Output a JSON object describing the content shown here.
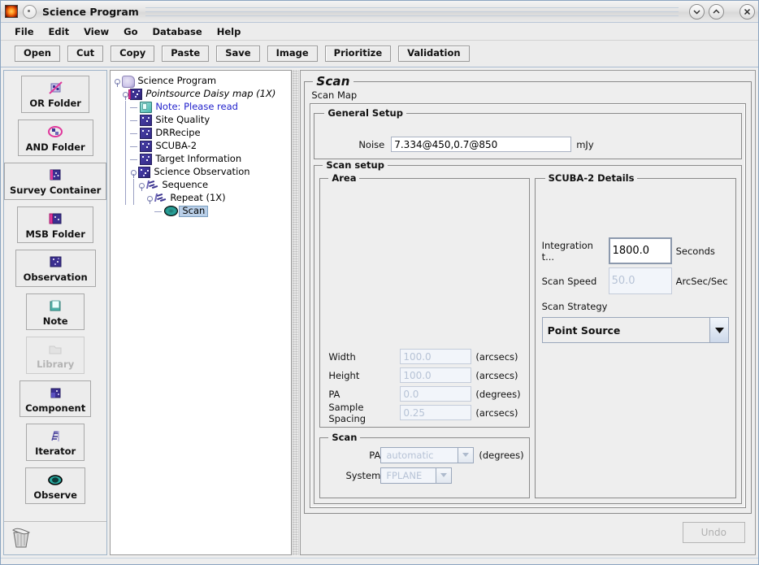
{
  "window": {
    "title": "Science Program",
    "controls": [
      {
        "name": "minimize-button",
        "glyph": "chevron-down"
      },
      {
        "name": "maximize-button",
        "glyph": "chevron-up"
      },
      {
        "name": "close-button",
        "glyph": "x"
      }
    ]
  },
  "menubar": {
    "items": [
      "File",
      "Edit",
      "View",
      "Go",
      "Database",
      "Help"
    ]
  },
  "toolbar": {
    "buttons": [
      "Open",
      "Cut",
      "Copy",
      "Paste",
      "Save",
      "Image",
      "Prioritize",
      "Validation"
    ]
  },
  "palette": {
    "items": [
      {
        "label": "OR Folder",
        "icon": "or-folder-icon",
        "disabled": false
      },
      {
        "label": "AND Folder",
        "icon": "and-folder-icon",
        "disabled": false
      },
      {
        "label": "Survey Container",
        "icon": "survey-container-icon",
        "disabled": false
      },
      {
        "label": "MSB Folder",
        "icon": "msb-folder-icon",
        "disabled": false
      },
      {
        "label": "Observation",
        "icon": "observation-icon",
        "disabled": false
      },
      {
        "label": "Note",
        "icon": "note-icon",
        "disabled": false
      },
      {
        "label": "Library",
        "icon": "library-icon",
        "disabled": true
      },
      {
        "label": "Component",
        "icon": "component-icon",
        "disabled": false
      },
      {
        "label": "Iterator",
        "icon": "iterator-icon",
        "disabled": false
      },
      {
        "label": "Observe",
        "icon": "observe-eye-icon",
        "disabled": false
      }
    ],
    "trash_icon": "trash-icon"
  },
  "tree": {
    "nodes": [
      {
        "label": "Science Program",
        "icon": "program-icon",
        "depth": 0,
        "handle": true,
        "italic": false,
        "note": false,
        "selected": false
      },
      {
        "label": "Pointsource Daisy map (1X)",
        "icon": "msb-icon",
        "depth": 1,
        "handle": true,
        "italic": true,
        "note": false,
        "selected": false
      },
      {
        "label": "Note: Please read",
        "icon": "note-icon",
        "depth": 2,
        "handle": false,
        "italic": false,
        "note": true,
        "selected": false
      },
      {
        "label": "Site Quality",
        "icon": "component-icon",
        "depth": 2,
        "handle": false,
        "italic": false,
        "note": false,
        "selected": false
      },
      {
        "label": "DRRecipe",
        "icon": "component-icon",
        "depth": 2,
        "handle": false,
        "italic": false,
        "note": false,
        "selected": false
      },
      {
        "label": "SCUBA-2",
        "icon": "component-icon",
        "depth": 2,
        "handle": false,
        "italic": false,
        "note": false,
        "selected": false
      },
      {
        "label": "Target Information",
        "icon": "component-icon",
        "depth": 2,
        "handle": false,
        "italic": false,
        "note": false,
        "selected": false
      },
      {
        "label": "Science Observation",
        "icon": "observation-icon",
        "depth": 2,
        "handle": true,
        "italic": false,
        "note": false,
        "selected": false
      },
      {
        "label": "Sequence",
        "icon": "sequence-icon",
        "depth": 3,
        "handle": true,
        "italic": false,
        "note": false,
        "selected": false
      },
      {
        "label": "Repeat (1X)",
        "icon": "iterator-icon",
        "depth": 4,
        "handle": true,
        "italic": false,
        "note": false,
        "selected": false
      },
      {
        "label": "Scan",
        "icon": "observe-eye-icon",
        "depth": 5,
        "handle": false,
        "italic": false,
        "note": false,
        "selected": true
      }
    ]
  },
  "scan": {
    "title": "Scan",
    "subtitle": "Scan Map",
    "general_setup": {
      "legend": "General Setup",
      "noise_label": "Noise",
      "noise_value": "7.334@450,0.7@850",
      "noise_unit": "mJy"
    },
    "scan_setup": {
      "legend": "Scan setup",
      "area": {
        "legend": "Area",
        "fields": [
          {
            "label": "Width",
            "value": "100.0",
            "unit": "(arcsecs)",
            "disabled": true
          },
          {
            "label": "Height",
            "value": "100.0",
            "unit": "(arcsecs)",
            "disabled": true
          },
          {
            "label": "PA",
            "value": "0.0",
            "unit": "(degrees)",
            "disabled": true
          },
          {
            "label": "Sample Spacing",
            "value": "0.25",
            "unit": "(arcsecs)",
            "disabled": true
          }
        ]
      },
      "scuba2": {
        "legend": "SCUBA-2 Details",
        "fields": [
          {
            "label": "Integration t...",
            "value": "1800.0",
            "unit": "Seconds",
            "disabled": false
          },
          {
            "label": "Scan Speed",
            "value": "50.0",
            "unit": "ArcSec/Sec",
            "disabled": true
          }
        ],
        "strategy_label": "Scan Strategy",
        "strategy_value": "Point Source"
      },
      "scan_bottom": {
        "legend": "Scan",
        "fields": [
          {
            "label": "PA",
            "value": "automatic",
            "unit": "(degrees)",
            "disabled": true
          },
          {
            "label": "System",
            "value": "FPLANE",
            "unit": "",
            "disabled": true
          }
        ]
      }
    },
    "undo_label": "Undo",
    "undo_disabled": true
  },
  "colors": {
    "accent_blue": "#2222cc",
    "selection": "#b9cfe8",
    "panel_bg": "#eeeeee",
    "field_disabled_text": "#b7c3d6"
  }
}
